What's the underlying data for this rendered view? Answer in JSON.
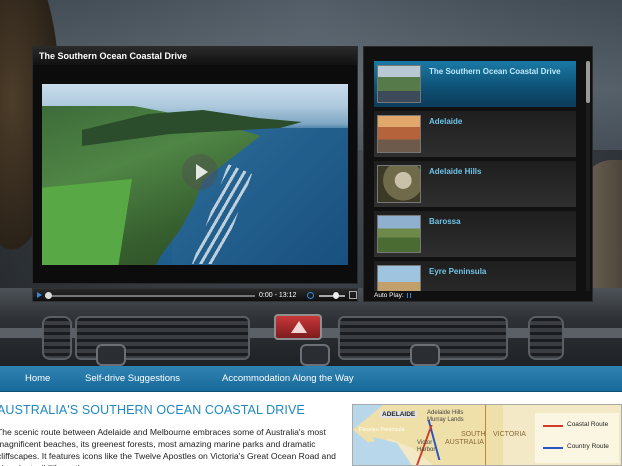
{
  "player": {
    "title": "The Southern Ocean Coastal Drive",
    "time": "0:00 - 13:12"
  },
  "playlist": {
    "items": [
      {
        "label": "The Southern Ocean Coastal Drive",
        "thumb": "coastal-road-thumbnail"
      },
      {
        "label": "Adelaide",
        "thumb": "city-skyline-thumbnail"
      },
      {
        "label": "Adelaide Hills",
        "thumb": "koala-thumbnail"
      },
      {
        "label": "Barossa",
        "thumb": "vineyard-thumbnail"
      },
      {
        "label": "Eyre Peninsula",
        "thumb": "coast-thumbnail"
      }
    ],
    "active_index": 0,
    "autoplay_label": "Auto Play:"
  },
  "nav": {
    "items": [
      "Home",
      "Self-drive Suggestions",
      "Accommodation Along the Way"
    ]
  },
  "content": {
    "title": "AUSTRALIA'S SOUTHERN OCEAN COASTAL DRIVE",
    "intro": "The scenic route between Adelaide and Melbourne embraces some of Australia's most magnificent beaches, its greenest forests, most amazing marine parks and dramatic cliffscapes. It features icons like the Twelve Apostles on Victoria's Great Ocean Road and abundant wildlife on the"
  },
  "map": {
    "labels": {
      "adelaide": "ADELAIDE",
      "hills": "Adelaide Hills",
      "murray": "Murray Lands",
      "fleurieu": "Fleurieu Peninsula",
      "victor": "Victor\nHarbor",
      "south": "SOUTH",
      "australia": "AUSTRALIA",
      "victoria": "VICTORIA"
    },
    "legend": {
      "coastal": "Coastal Route",
      "country": "Country Route"
    },
    "colors": {
      "coastal": "#d23a2a",
      "country": "#2a54c4"
    }
  },
  "colors": {
    "accent": "#1f88c0",
    "nav": "#2379a8",
    "playlist_active": "#1a7aa6"
  }
}
